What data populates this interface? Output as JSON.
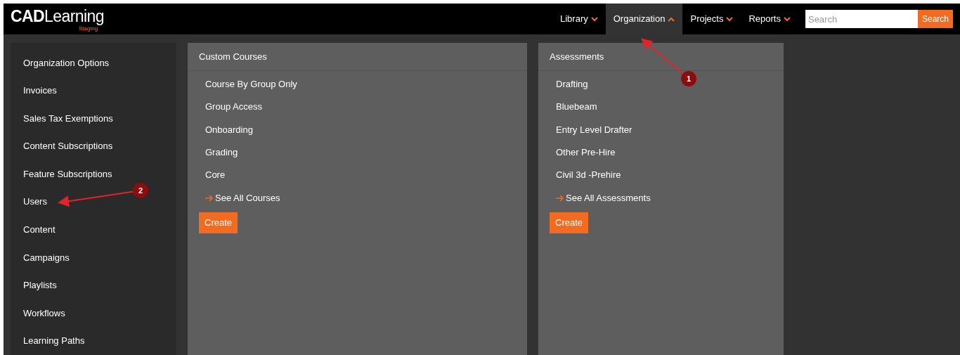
{
  "header": {
    "logo": "**CAD**Learning",
    "logo_sub": "Staging"
  },
  "nav": [
    {
      "label": "Library",
      "expanded": false
    },
    {
      "label": "Organization",
      "expanded": true
    },
    {
      "label": "Projects",
      "expanded": false
    },
    {
      "label": "Reports",
      "expanded": false
    }
  ],
  "search": {
    "placeholder": "Search",
    "button": "Search"
  },
  "menu": {
    "items": [
      "Organization Options",
      "Invoices",
      "Sales Tax Exemptions",
      "Content Subscriptions",
      "Feature Subscriptions",
      "Users",
      "Content",
      "Campaigns",
      "Playlists",
      "Workflows",
      "Learning Paths"
    ]
  },
  "panels": [
    {
      "title": "Custom Courses",
      "items": [
        "Course By Group Only",
        "Group Access",
        "Onboarding",
        "Grading",
        "Core"
      ],
      "see_all": "See All Courses",
      "create": "Create"
    },
    {
      "title": "Assessments",
      "items": [
        "Drafting",
        "Bluebeam",
        "Entry Level Drafter",
        "Other Pre-Hire",
        "Civil 3d -Prehire"
      ],
      "see_all": "See All Assessments",
      "create": "Create"
    }
  ],
  "annotations": [
    {
      "number": "1"
    },
    {
      "number": "2"
    }
  ]
}
